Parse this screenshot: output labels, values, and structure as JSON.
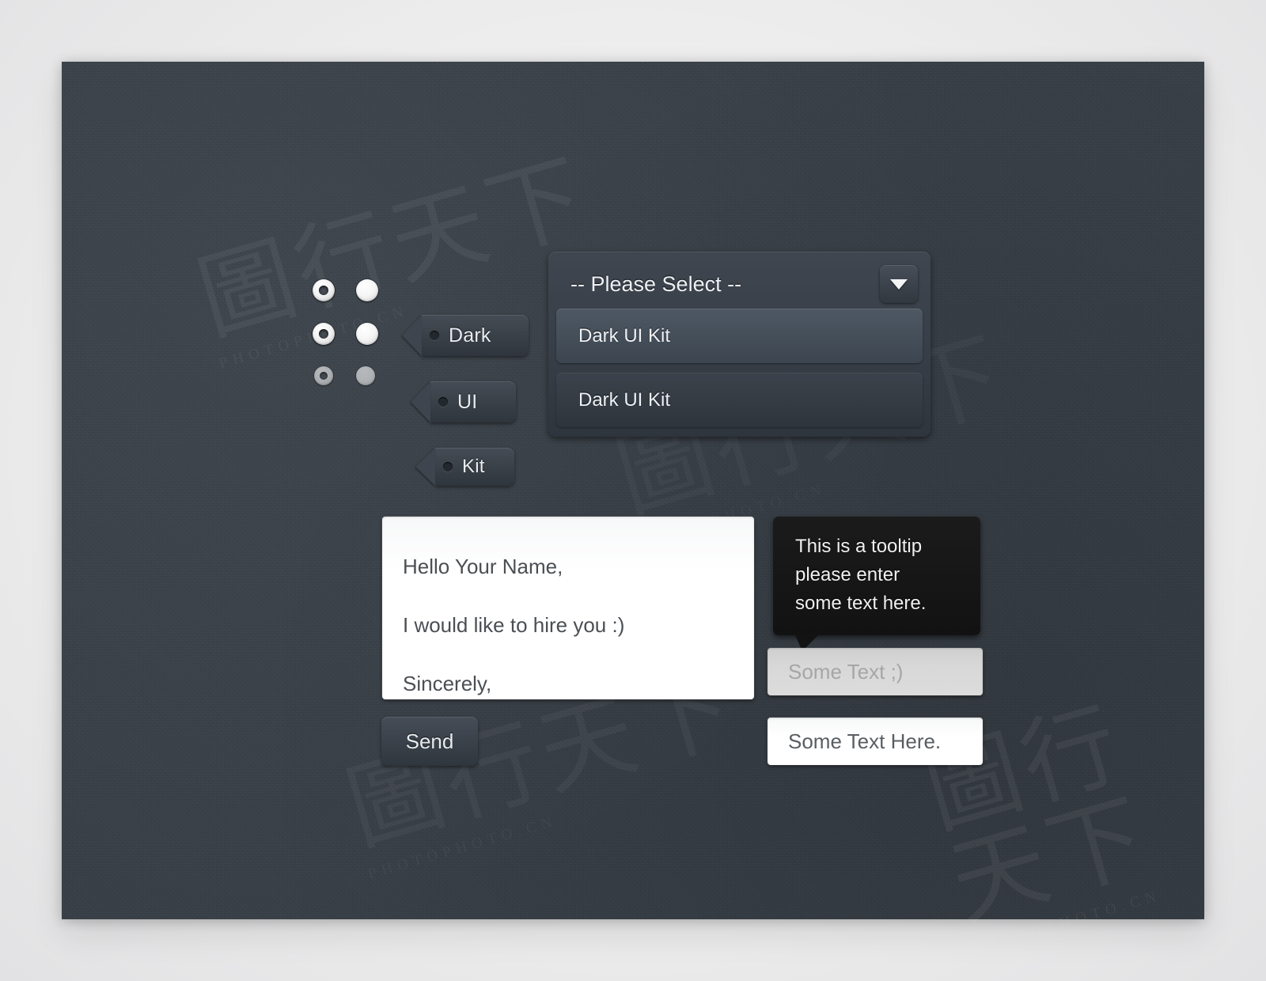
{
  "panel": {
    "background_color": "#353c44",
    "page_background_color": "#ececec"
  },
  "radio_group": {
    "name": "radio-buttons",
    "rows": [
      {
        "ring_state": "unselected-ring",
        "solid_state": "selected-filled",
        "disabled": false
      },
      {
        "ring_state": "unselected-ring",
        "solid_state": "selected-filled",
        "disabled": false
      },
      {
        "ring_state": "unselected-ring",
        "solid_state": "selected-filled",
        "disabled": true
      }
    ]
  },
  "tags": [
    {
      "label": "Dark",
      "icon": "tag-hole-icon"
    },
    {
      "label": "UI",
      "icon": "tag-hole-icon"
    },
    {
      "label": "Kit",
      "icon": "tag-hole-icon"
    }
  ],
  "select": {
    "placeholder_label": "-- Please Select --",
    "arrow_icon": "chevron-down-icon",
    "options": [
      {
        "label": "Dark UI Kit",
        "selected": true
      },
      {
        "label": "Dark UI Kit",
        "selected": false
      }
    ]
  },
  "textarea": {
    "lines": [
      "Hello Your Name,",
      "I would like to hire you :)",
      "Sincerely,"
    ]
  },
  "send_button": {
    "label": "Send"
  },
  "tooltip": {
    "lines": [
      "This is a tooltip",
      "please enter",
      "some text here."
    ]
  },
  "inputs": {
    "disabled_field": {
      "placeholder": "Some Text ;)",
      "value": "",
      "state": "disabled"
    },
    "active_field": {
      "value": "Some Text Here.",
      "state": "filled"
    }
  },
  "watermark": {
    "glyph": "圖行天下",
    "sub": "PHOTOPHOTO.CN"
  }
}
